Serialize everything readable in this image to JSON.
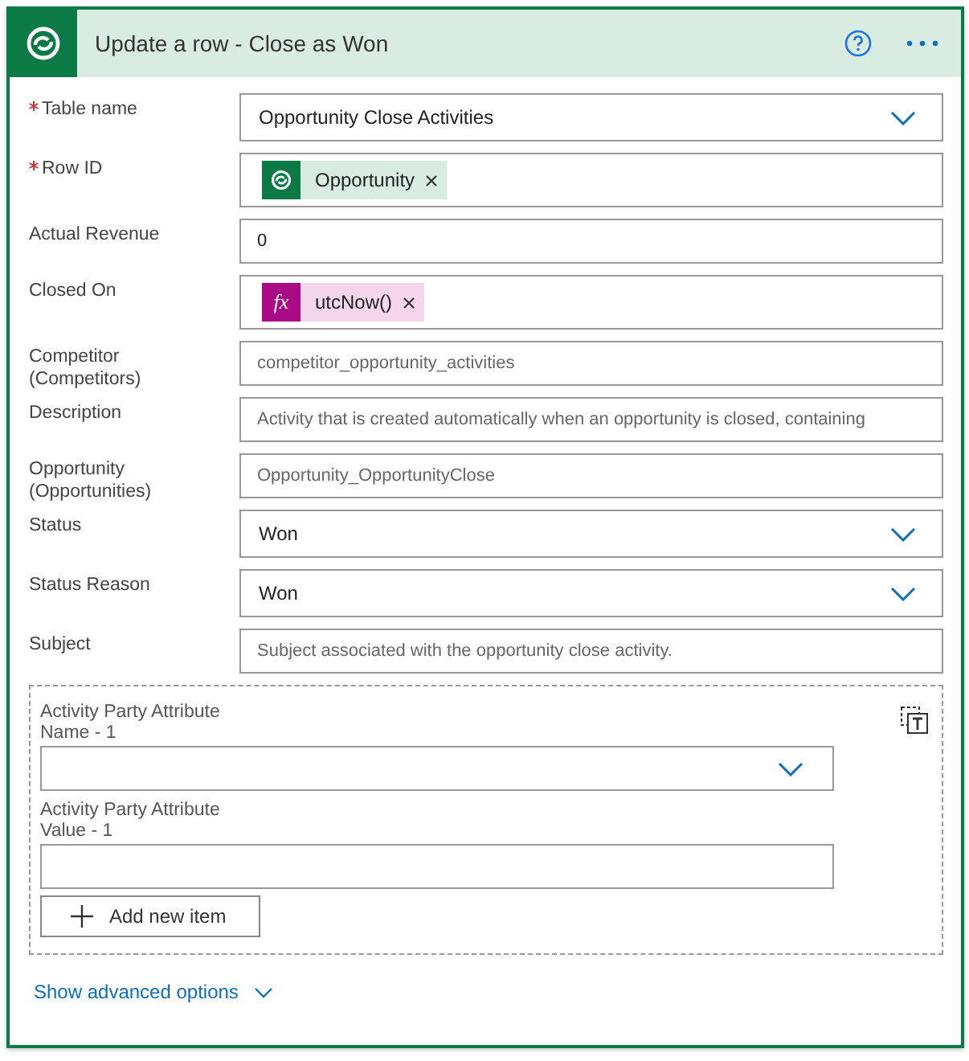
{
  "header": {
    "title": "Update a row - Close as Won"
  },
  "fields": [
    {
      "label": "Table name",
      "required": true,
      "kind": "dropdown",
      "value": "Opportunity Close Activities"
    },
    {
      "label": "Row ID",
      "required": true,
      "kind": "token",
      "token": {
        "kind": "dataverse",
        "text": "Opportunity"
      }
    },
    {
      "label": "Actual Revenue",
      "required": false,
      "kind": "text",
      "value": "0"
    },
    {
      "label": "Closed On",
      "required": false,
      "kind": "token",
      "token": {
        "kind": "expression",
        "icon_label": "fx",
        "text": "utcNow()"
      }
    },
    {
      "label": "Competitor (Competitors)",
      "required": false,
      "kind": "text",
      "placeholder": "competitor_opportunity_activities"
    },
    {
      "label": "Description",
      "required": false,
      "kind": "text",
      "placeholder": "Activity that is created automatically when an opportunity is closed, containing"
    },
    {
      "label": "Opportunity (Opportunities)",
      "required": false,
      "kind": "text",
      "placeholder": "Opportunity_OpportunityClose"
    },
    {
      "label": "Status",
      "required": false,
      "kind": "dropdown",
      "value": "Won"
    },
    {
      "label": "Status Reason",
      "required": false,
      "kind": "dropdown",
      "value": "Won"
    },
    {
      "label": "Subject",
      "required": false,
      "kind": "text",
      "placeholder": "Subject associated with the opportunity close activity."
    }
  ],
  "array": {
    "items": [
      {
        "label": "Activity Party Attribute Name - 1",
        "kind": "dropdown"
      },
      {
        "label": "Activity Party Attribute Value - 1",
        "kind": "text"
      }
    ],
    "add_button": "Add new item"
  },
  "advanced_link": "Show advanced options"
}
